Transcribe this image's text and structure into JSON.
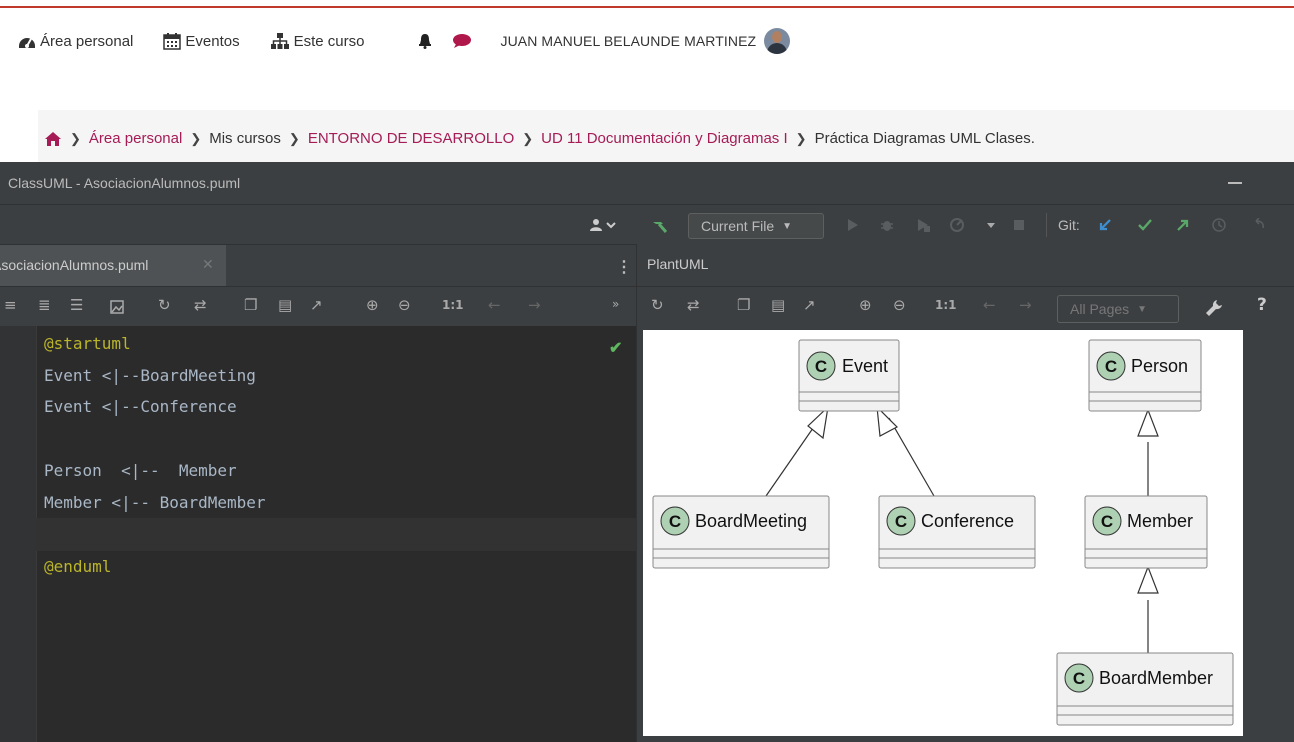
{
  "topnav": {
    "area_personal": "Área personal",
    "eventos": "Eventos",
    "este_curso": "Este curso",
    "user_name": "JUAN MANUEL BELAUNDE MARTINEZ"
  },
  "breadcrumb": {
    "items": [
      "Área personal",
      "Mis cursos",
      "ENTORNO DE DESARROLLO",
      "UD 11 Documentación y Diagramas I",
      "Práctica Diagramas UML Clases."
    ]
  },
  "ide": {
    "window_title": "ClassUML - AsociacionAlumnos.puml",
    "run_config": "Current File",
    "git_label": "Git:",
    "editor_tab": "AsociacionAlumnos.puml",
    "preview_tab": "PlantUML",
    "zoom_reset_label": "1:1",
    "pages_select": "All Pages"
  },
  "code": {
    "lines": [
      "@startuml",
      "Event <|--BoardMeeting",
      "Event <|--Conference",
      "",
      "Person  <|--  Member",
      "Member <|-- BoardMember",
      "",
      "@enduml"
    ]
  },
  "uml": {
    "class_marker": "C",
    "classes": [
      "Event",
      "Person",
      "BoardMeeting",
      "Conference",
      "Member",
      "BoardMember"
    ]
  },
  "colors": {
    "accent": "#a51c56",
    "ide_bg": "#3c3f41",
    "editor_bg": "#2b2b2b",
    "keyword": "#bbb529",
    "class_marker_fill": "#add1b2"
  }
}
